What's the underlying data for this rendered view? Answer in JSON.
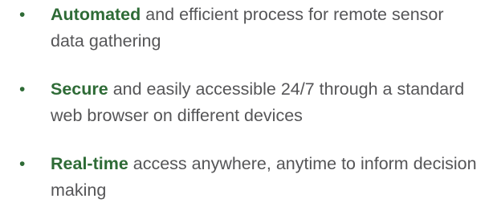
{
  "bullets": {
    "marker": "•",
    "accent_color": "#2e6b36",
    "text_color": "#555557",
    "items": [
      {
        "strong": "Automated",
        "text": " and efficient process for remote sensor data gathering"
      },
      {
        "strong": "Secure",
        "text": " and easily accessible 24/7 through a standard web browser on different devices"
      },
      {
        "strong": "Real-time",
        "text": " access anywhere, anytime to inform decision making"
      }
    ]
  }
}
